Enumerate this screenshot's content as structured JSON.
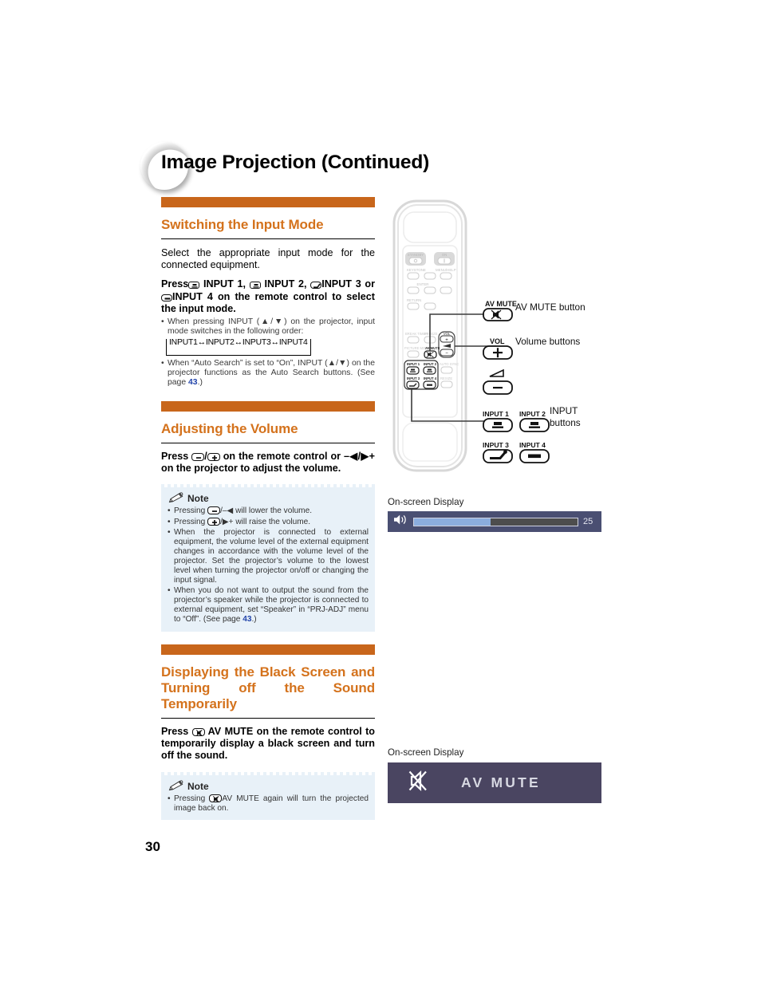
{
  "page": {
    "title": "Image Projection (Continued)",
    "number": "30"
  },
  "sections": {
    "input_mode": {
      "heading": "Switching the Input Mode",
      "intro": "Select the appropriate input mode for the connected equipment.",
      "instruction_parts": {
        "press": "Press",
        "input1": "INPUT   1,",
        "input2": "INPUT   2,",
        "input3": "INPUT 3 or",
        "input4": "INPUT 4 on the remote control to select the input mode."
      },
      "bullets": [
        "When pressing INPUT (▲/▼) on the projector, input mode switches in the following order:",
        "When “Auto Search” is set to “On”, INPUT (▲/▼) on the projector functions as the Auto Search buttons. (See page "
      ],
      "loop_text": "INPUT1↔INPUT2↔INPUT3↔INPUT4",
      "page_ref": "43",
      "page_ref_tail": ".)"
    },
    "volume": {
      "heading": "Adjusting the Volume",
      "instruction_prefix": "Press",
      "instruction_mid": "on the remote control or",
      "instruction_suffix": "–◀/▶+ on the projector to adjust the volume.",
      "note_title": "Note",
      "notes": [
        "Pressing",
        "/–◀ will lower the volume.",
        "/▶+ will raise the volume.",
        "When the projector is connected to external equipment, the volume level of the external equipment changes in accordance with the volume level of the projector. Set the projector’s volume to the lowest level when turning the projector on/off or changing the input signal.",
        "When you do not want to output the sound from the projector’s speaker while the projector is connected to external equipment, set “Speaker” in “PRJ-ADJ” menu to “Off”. (See page "
      ],
      "note_pressing": "Pressing",
      "page_ref": "43",
      "page_ref_tail": ".)"
    },
    "av_mute": {
      "heading": "Displaying the Black Screen and Turning off the Sound Temporarily",
      "instruction_prefix": "Press",
      "instruction_suffix": "AV MUTE on the remote control to temporarily display a black screen and turn off the sound.",
      "note_title": "Note",
      "note_prefix": "Pressing",
      "note_suffix": "AV MUTE again will turn the projected image back on."
    }
  },
  "callouts": {
    "av_mute_button": "AV MUTE button",
    "volume_buttons": "Volume buttons",
    "input_buttons_line1": "INPUT",
    "input_buttons_line2": "buttons"
  },
  "remote_labels": {
    "standby": "STANDBY",
    "on": "ON",
    "keystone": "KEYSTONE",
    "menu_help": "MENU/HELP",
    "enter": "ENTER",
    "return": "RETURN",
    "break_timer": "BREAK TIMER",
    "freeze": "FREEZE",
    "picture_mode": "PICTURE MODE",
    "av_mute": "AV MUTE",
    "vol": "VOL",
    "auto_sync": "AUTO SYNC",
    "resize": "RESIZE",
    "input1": "INPUT 1",
    "input2": "INPUT 2",
    "input3": "INPUT 3",
    "input4": "INPUT 4"
  },
  "enlarged_keys": {
    "av_mute": "AV MUTE",
    "vol": "VOL",
    "input1": "INPUT 1",
    "input2": "INPUT 2",
    "input3": "INPUT 3",
    "input4": "INPUT 4"
  },
  "osd": {
    "label": "On-screen Display",
    "volume_value": "25",
    "volume_percent": 47,
    "av_mute_text": "AV MUTE"
  },
  "colors": {
    "accent_orange": "#d4721c",
    "bar_orange": "#c8661b",
    "note_bg": "#e8f1f8",
    "osd_vol_bg": "#4a4f72",
    "osd_vol_fill": "#8badde",
    "osd_vol_track": "#4d4d4d",
    "osd_mute_bg": "#4a4561",
    "page_ref_blue": "#2244aa"
  }
}
